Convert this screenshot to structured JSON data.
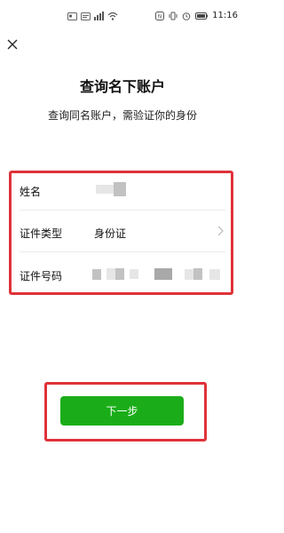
{
  "status_bar": {
    "time": "11:16",
    "icons": [
      "id-card-icon",
      "notification-icon",
      "signal-icon",
      "wifi-icon",
      "nfc-icon",
      "vibrate-icon",
      "alarm-icon",
      "battery-icon"
    ]
  },
  "header": {
    "close_icon": "close-icon",
    "title": "查询名下账户",
    "subtitle": "查询同名账户，需验证你的身份"
  },
  "form": {
    "highlight_color": "#e0323a",
    "rows": [
      {
        "label": "姓名",
        "value": ""
      },
      {
        "label": "证件类型",
        "value": "身份证"
      },
      {
        "label": "证件号码",
        "value": ""
      }
    ]
  },
  "actions": {
    "next_label": "下一步",
    "next_color": "#1aad19",
    "highlight_color": "#e0323a"
  }
}
